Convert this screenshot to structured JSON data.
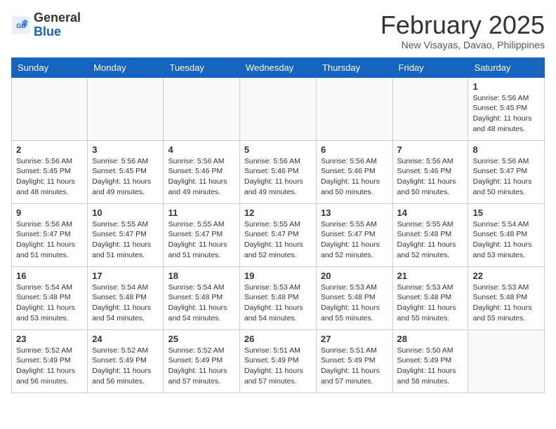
{
  "header": {
    "logo_general": "General",
    "logo_blue": "Blue",
    "month_title": "February 2025",
    "location": "New Visayas, Davao, Philippines"
  },
  "weekdays": [
    "Sunday",
    "Monday",
    "Tuesday",
    "Wednesday",
    "Thursday",
    "Friday",
    "Saturday"
  ],
  "weeks": [
    [
      {
        "day": "",
        "info": ""
      },
      {
        "day": "",
        "info": ""
      },
      {
        "day": "",
        "info": ""
      },
      {
        "day": "",
        "info": ""
      },
      {
        "day": "",
        "info": ""
      },
      {
        "day": "",
        "info": ""
      },
      {
        "day": "1",
        "info": "Sunrise: 5:56 AM\nSunset: 5:45 PM\nDaylight: 11 hours\nand 48 minutes."
      }
    ],
    [
      {
        "day": "2",
        "info": "Sunrise: 5:56 AM\nSunset: 5:45 PM\nDaylight: 11 hours\nand 48 minutes."
      },
      {
        "day": "3",
        "info": "Sunrise: 5:56 AM\nSunset: 5:45 PM\nDaylight: 11 hours\nand 49 minutes."
      },
      {
        "day": "4",
        "info": "Sunrise: 5:56 AM\nSunset: 5:46 PM\nDaylight: 11 hours\nand 49 minutes."
      },
      {
        "day": "5",
        "info": "Sunrise: 5:56 AM\nSunset: 5:46 PM\nDaylight: 11 hours\nand 49 minutes."
      },
      {
        "day": "6",
        "info": "Sunrise: 5:56 AM\nSunset: 5:46 PM\nDaylight: 11 hours\nand 50 minutes."
      },
      {
        "day": "7",
        "info": "Sunrise: 5:56 AM\nSunset: 5:46 PM\nDaylight: 11 hours\nand 50 minutes."
      },
      {
        "day": "8",
        "info": "Sunrise: 5:56 AM\nSunset: 5:47 PM\nDaylight: 11 hours\nand 50 minutes."
      }
    ],
    [
      {
        "day": "9",
        "info": "Sunrise: 5:56 AM\nSunset: 5:47 PM\nDaylight: 11 hours\nand 51 minutes."
      },
      {
        "day": "10",
        "info": "Sunrise: 5:55 AM\nSunset: 5:47 PM\nDaylight: 11 hours\nand 51 minutes."
      },
      {
        "day": "11",
        "info": "Sunrise: 5:55 AM\nSunset: 5:47 PM\nDaylight: 11 hours\nand 51 minutes."
      },
      {
        "day": "12",
        "info": "Sunrise: 5:55 AM\nSunset: 5:47 PM\nDaylight: 11 hours\nand 52 minutes."
      },
      {
        "day": "13",
        "info": "Sunrise: 5:55 AM\nSunset: 5:47 PM\nDaylight: 11 hours\nand 52 minutes."
      },
      {
        "day": "14",
        "info": "Sunrise: 5:55 AM\nSunset: 5:48 PM\nDaylight: 11 hours\nand 52 minutes."
      },
      {
        "day": "15",
        "info": "Sunrise: 5:54 AM\nSunset: 5:48 PM\nDaylight: 11 hours\nand 53 minutes."
      }
    ],
    [
      {
        "day": "16",
        "info": "Sunrise: 5:54 AM\nSunset: 5:48 PM\nDaylight: 11 hours\nand 53 minutes."
      },
      {
        "day": "17",
        "info": "Sunrise: 5:54 AM\nSunset: 5:48 PM\nDaylight: 11 hours\nand 54 minutes."
      },
      {
        "day": "18",
        "info": "Sunrise: 5:54 AM\nSunset: 5:48 PM\nDaylight: 11 hours\nand 54 minutes."
      },
      {
        "day": "19",
        "info": "Sunrise: 5:53 AM\nSunset: 5:48 PM\nDaylight: 11 hours\nand 54 minutes."
      },
      {
        "day": "20",
        "info": "Sunrise: 5:53 AM\nSunset: 5:48 PM\nDaylight: 11 hours\nand 55 minutes."
      },
      {
        "day": "21",
        "info": "Sunrise: 5:53 AM\nSunset: 5:48 PM\nDaylight: 11 hours\nand 55 minutes."
      },
      {
        "day": "22",
        "info": "Sunrise: 5:53 AM\nSunset: 5:48 PM\nDaylight: 11 hours\nand 55 minutes."
      }
    ],
    [
      {
        "day": "23",
        "info": "Sunrise: 5:52 AM\nSunset: 5:49 PM\nDaylight: 11 hours\nand 56 minutes."
      },
      {
        "day": "24",
        "info": "Sunrise: 5:52 AM\nSunset: 5:49 PM\nDaylight: 11 hours\nand 56 minutes."
      },
      {
        "day": "25",
        "info": "Sunrise: 5:52 AM\nSunset: 5:49 PM\nDaylight: 11 hours\nand 57 minutes."
      },
      {
        "day": "26",
        "info": "Sunrise: 5:51 AM\nSunset: 5:49 PM\nDaylight: 11 hours\nand 57 minutes."
      },
      {
        "day": "27",
        "info": "Sunrise: 5:51 AM\nSunset: 5:49 PM\nDaylight: 11 hours\nand 57 minutes."
      },
      {
        "day": "28",
        "info": "Sunrise: 5:50 AM\nSunset: 5:49 PM\nDaylight: 11 hours\nand 58 minutes."
      },
      {
        "day": "",
        "info": ""
      }
    ]
  ]
}
